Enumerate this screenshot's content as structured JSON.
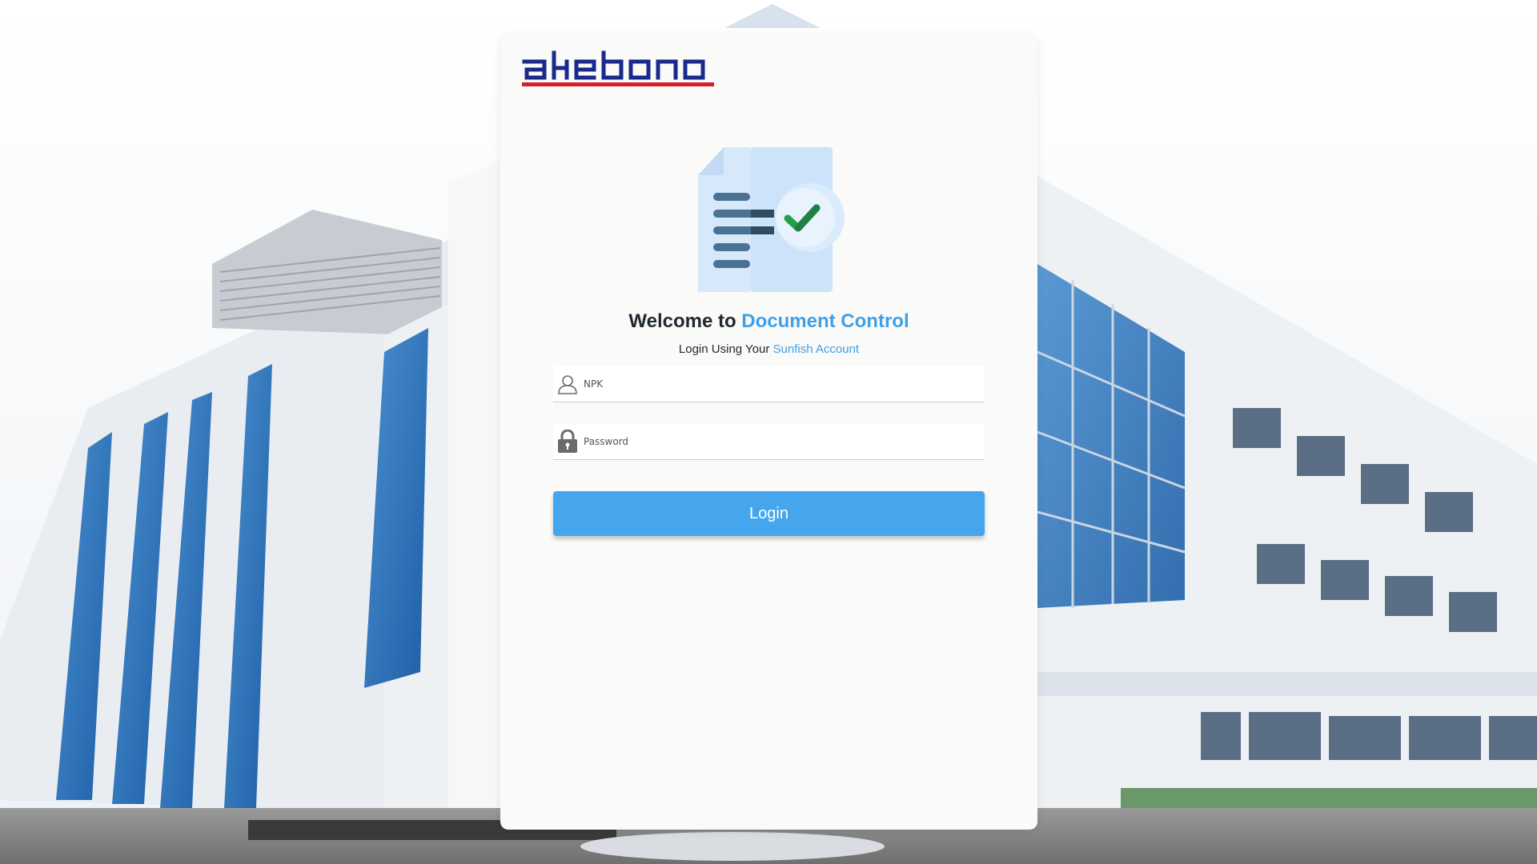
{
  "brand": {
    "logo_text": "akebono",
    "logo_color": "#1a2a8c",
    "logo_underline_color": "#d41f26"
  },
  "login": {
    "welcome_prefix": "Welcome to",
    "welcome_highlight": "Document Control",
    "subtitle_prefix": "Login Using Your",
    "subtitle_highlight": "Sunfish Account",
    "npk_placeholder": "NPK",
    "password_placeholder": "Password",
    "login_button": "Login"
  },
  "icons": {
    "hero": "document-check-icon",
    "npk": "user-icon",
    "password": "lock-icon"
  },
  "colors": {
    "accent": "#3fa0e8",
    "button": "#45a6ee",
    "card": "#fafaf8"
  }
}
